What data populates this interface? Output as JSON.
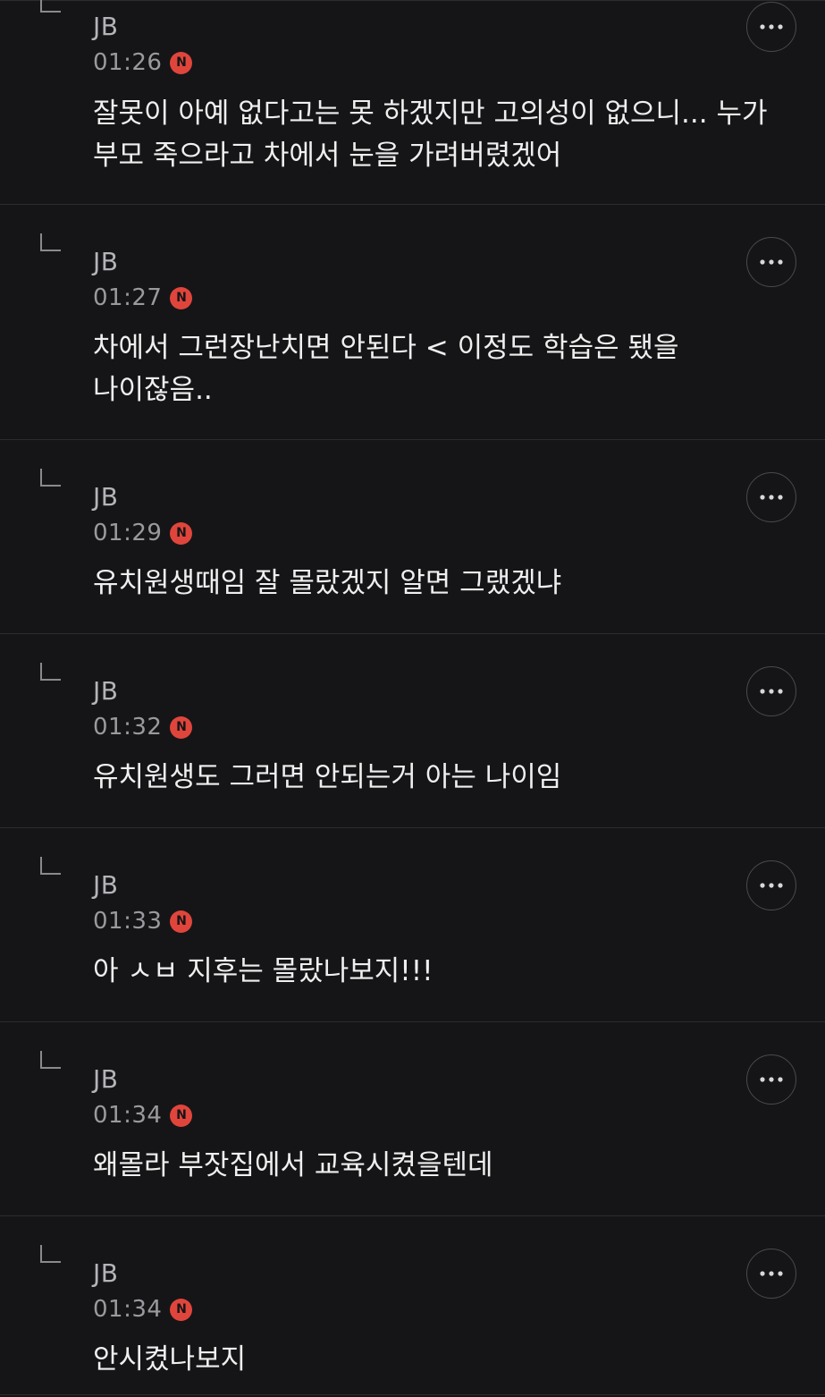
{
  "badge_text": "N",
  "colors": {
    "background": "#151517",
    "divider": "#2c2c30",
    "new_badge": "#e0453c",
    "author_text": "#b4b4b8",
    "time_text": "#9a9a9e",
    "body_text": "#efefef"
  },
  "icons": {
    "reply_indent": "reply-arrow-icon",
    "more": "more-horizontal-icon"
  },
  "replies": [
    {
      "author": "JB",
      "time": "01:26",
      "is_new": true,
      "text": "잘못이 아예 없다고는 못 하겠지만 고의성이 없으니... 누가 부모 죽으라고 차에서 눈을 가려버렸겠어"
    },
    {
      "author": "JB",
      "time": "01:27",
      "is_new": true,
      "text": "차에서 그런장난치면 안된다 < 이정도 학습은 됐을 나이잖음.."
    },
    {
      "author": "JB",
      "time": "01:29",
      "is_new": true,
      "text": "유치원생때임 잘 몰랐겠지 알면 그랬겠냐"
    },
    {
      "author": "JB",
      "time": "01:32",
      "is_new": true,
      "text": "유치원생도 그러면 안되는거 아는 나이임"
    },
    {
      "author": "JB",
      "time": "01:33",
      "is_new": true,
      "text": "아 ㅅㅂ 지후는 몰랐나보지!!!"
    },
    {
      "author": "JB",
      "time": "01:34",
      "is_new": true,
      "text": "왜몰라 부잣집에서 교육시켰을텐데"
    },
    {
      "author": "JB",
      "time": "01:34",
      "is_new": true,
      "text": "안시켰나보지"
    }
  ]
}
